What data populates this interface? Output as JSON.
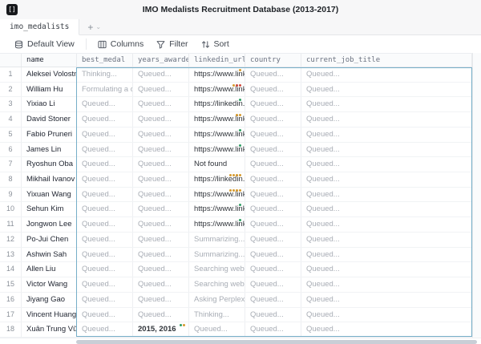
{
  "app": {
    "title": "IMO Medalists Recruitment Database (2013-2017)",
    "logo_glyph": "[]"
  },
  "tabs": {
    "active_tab": "imo_medalists",
    "add_label": "+",
    "chevron": "⌄"
  },
  "toolbar": {
    "view_label": "Default View",
    "columns_label": "Columns",
    "filter_label": "Filter",
    "sort_label": "Sort"
  },
  "colors": {
    "amber": "#d69a2d",
    "red": "#cf4a3c",
    "green": "#2f9e63",
    "selection_border": "#76aec8"
  },
  "table": {
    "columns": [
      "name",
      "best_medal",
      "years_awarded",
      "linkedin_url",
      "country",
      "current_job_title"
    ],
    "rows": [
      {
        "num": "1",
        "name": "Aleksei Volostnov",
        "cells": [
          {
            "t": "Thinking...",
            "s": "muted"
          },
          {
            "t": "Queued...",
            "s": "muted"
          },
          {
            "t": "https://www.linkedi",
            "s": "dark",
            "dots": [
              "amber"
            ]
          },
          {
            "t": "Queued...",
            "s": "muted"
          },
          {
            "t": "Queued...",
            "s": "muted"
          }
        ]
      },
      {
        "num": "2",
        "name": "William Hu",
        "cells": [
          {
            "t": "Formulating a quer",
            "s": "muted"
          },
          {
            "t": "Queued...",
            "s": "muted"
          },
          {
            "t": "https://www.linkedi",
            "s": "dark",
            "dots": [
              "amber",
              "red",
              "red"
            ]
          },
          {
            "t": "Queued...",
            "s": "muted"
          },
          {
            "t": "Queued...",
            "s": "muted"
          }
        ]
      },
      {
        "num": "3",
        "name": "Yixiao Li",
        "cells": [
          {
            "t": "Queued...",
            "s": "muted"
          },
          {
            "t": "Queued...",
            "s": "muted"
          },
          {
            "t": "https://linkedin.com",
            "s": "dark",
            "dots": [
              "green"
            ]
          },
          {
            "t": "Queued...",
            "s": "muted"
          },
          {
            "t": "Queued...",
            "s": "muted"
          }
        ]
      },
      {
        "num": "4",
        "name": "David Stoner",
        "cells": [
          {
            "t": "Queued...",
            "s": "muted"
          },
          {
            "t": "Queued...",
            "s": "muted"
          },
          {
            "t": "https://www.linkedi",
            "s": "dark",
            "dots": [
              "amber",
              "amber"
            ]
          },
          {
            "t": "Queued...",
            "s": "muted"
          },
          {
            "t": "Queued...",
            "s": "muted"
          }
        ]
      },
      {
        "num": "5",
        "name": "Fabio Pruneri",
        "cells": [
          {
            "t": "Queued...",
            "s": "muted"
          },
          {
            "t": "Queued...",
            "s": "muted"
          },
          {
            "t": "https://www.linkedi",
            "s": "dark",
            "dots": [
              "green"
            ]
          },
          {
            "t": "Queued...",
            "s": "muted"
          },
          {
            "t": "Queued...",
            "s": "muted"
          }
        ]
      },
      {
        "num": "6",
        "name": "James Lin",
        "cells": [
          {
            "t": "Queued...",
            "s": "muted"
          },
          {
            "t": "Queued...",
            "s": "muted"
          },
          {
            "t": "https://www.linkedi",
            "s": "dark",
            "dots": [
              "green"
            ]
          },
          {
            "t": "Queued...",
            "s": "muted"
          },
          {
            "t": "Queued...",
            "s": "muted"
          }
        ]
      },
      {
        "num": "7",
        "name": "Ryoshun Oba",
        "cells": [
          {
            "t": "Queued...",
            "s": "muted"
          },
          {
            "t": "Queued...",
            "s": "muted"
          },
          {
            "t": "Not found",
            "s": "dark"
          },
          {
            "t": "Queued...",
            "s": "muted"
          },
          {
            "t": "Queued...",
            "s": "muted"
          }
        ]
      },
      {
        "num": "8",
        "name": "Mikhail Ivanov",
        "cells": [
          {
            "t": "Queued...",
            "s": "muted"
          },
          {
            "t": "Queued...",
            "s": "muted"
          },
          {
            "t": "https://linkedin.com",
            "s": "dark",
            "dots": [
              "amber",
              "amber",
              "amber",
              "amber"
            ]
          },
          {
            "t": "Queued...",
            "s": "muted"
          },
          {
            "t": "Queued...",
            "s": "muted"
          }
        ]
      },
      {
        "num": "9",
        "name": "Yixuan Wang",
        "cells": [
          {
            "t": "Queued...",
            "s": "muted"
          },
          {
            "t": "Queued...",
            "s": "muted"
          },
          {
            "t": "https://www.linkedi",
            "s": "dark",
            "dots": [
              "amber",
              "amber",
              "amber",
              "amber"
            ]
          },
          {
            "t": "Queued...",
            "s": "muted"
          },
          {
            "t": "Queued...",
            "s": "muted"
          }
        ]
      },
      {
        "num": "10",
        "name": "Sehun Kim",
        "cells": [
          {
            "t": "Queued...",
            "s": "muted"
          },
          {
            "t": "Queued...",
            "s": "muted"
          },
          {
            "t": "https://www.linkedi",
            "s": "dark",
            "dots": [
              "green"
            ]
          },
          {
            "t": "Queued...",
            "s": "muted"
          },
          {
            "t": "Queued...",
            "s": "muted"
          }
        ]
      },
      {
        "num": "11",
        "name": "Jongwon Lee",
        "cells": [
          {
            "t": "Queued...",
            "s": "muted"
          },
          {
            "t": "Queued...",
            "s": "muted"
          },
          {
            "t": "https://www.linkedi",
            "s": "dark",
            "dots": [
              "green"
            ]
          },
          {
            "t": "Queued...",
            "s": "muted"
          },
          {
            "t": "Queued...",
            "s": "muted"
          }
        ]
      },
      {
        "num": "12",
        "name": "Po-Jui Chen",
        "cells": [
          {
            "t": "Queued...",
            "s": "muted"
          },
          {
            "t": "Queued...",
            "s": "muted"
          },
          {
            "t": "Summarizing...",
            "s": "muted"
          },
          {
            "t": "Queued...",
            "s": "muted"
          },
          {
            "t": "Queued...",
            "s": "muted"
          }
        ]
      },
      {
        "num": "13",
        "name": "Ashwin Sah",
        "cells": [
          {
            "t": "Queued...",
            "s": "muted"
          },
          {
            "t": "Queued...",
            "s": "muted"
          },
          {
            "t": "Summarizing...",
            "s": "muted"
          },
          {
            "t": "Queued...",
            "s": "muted"
          },
          {
            "t": "Queued...",
            "s": "muted"
          }
        ]
      },
      {
        "num": "14",
        "name": "Allen Liu",
        "cells": [
          {
            "t": "Queued...",
            "s": "muted"
          },
          {
            "t": "Queued...",
            "s": "muted"
          },
          {
            "t": "Searching web...",
            "s": "muted"
          },
          {
            "t": "Queued...",
            "s": "muted"
          },
          {
            "t": "Queued...",
            "s": "muted"
          }
        ]
      },
      {
        "num": "15",
        "name": "Victor Wang",
        "cells": [
          {
            "t": "Queued...",
            "s": "muted"
          },
          {
            "t": "Queued...",
            "s": "muted"
          },
          {
            "t": "Searching web...",
            "s": "muted"
          },
          {
            "t": "Queued...",
            "s": "muted"
          },
          {
            "t": "Queued...",
            "s": "muted"
          }
        ]
      },
      {
        "num": "16",
        "name": "Jiyang Gao",
        "cells": [
          {
            "t": "Queued...",
            "s": "muted"
          },
          {
            "t": "Queued...",
            "s": "muted"
          },
          {
            "t": "Asking Perplexity...",
            "s": "muted"
          },
          {
            "t": "Queued...",
            "s": "muted"
          },
          {
            "t": "Queued...",
            "s": "muted"
          }
        ]
      },
      {
        "num": "17",
        "name": "Vincent Huang",
        "cells": [
          {
            "t": "Queued...",
            "s": "muted"
          },
          {
            "t": "Queued...",
            "s": "muted"
          },
          {
            "t": "Thinking...",
            "s": "muted"
          },
          {
            "t": "Queued...",
            "s": "muted"
          },
          {
            "t": "Queued...",
            "s": "muted"
          }
        ]
      },
      {
        "num": "18",
        "name": "Xuân Trung Vũ",
        "cells": [
          {
            "t": "Queued...",
            "s": "muted"
          },
          {
            "t": "2015, 2016",
            "s": "dark bold",
            "dots": [
              "green",
              "amber"
            ]
          },
          {
            "t": "Queued...",
            "s": "muted"
          },
          {
            "t": "Queued...",
            "s": "muted"
          },
          {
            "t": "Queued...",
            "s": "muted"
          }
        ]
      }
    ]
  }
}
